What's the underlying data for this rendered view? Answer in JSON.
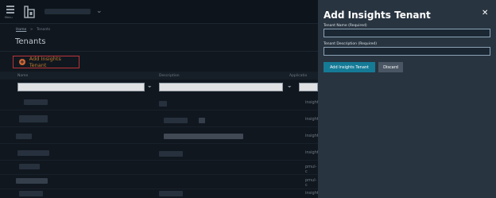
{
  "topbar": {
    "menu_label": "Menu"
  },
  "breadcrumb": {
    "home": "Home",
    "separator": ">",
    "current": "Tenants"
  },
  "page": {
    "title": "Tenants"
  },
  "toolbar": {
    "add_label": "Add Insights Tenant",
    "add_icon": "plus-circle-icon",
    "accent": "#c8393d"
  },
  "table": {
    "columns": [
      "Name",
      "Description",
      "Applicatio"
    ],
    "filter_icon": "funnel-icon",
    "app_cells": [
      "insights",
      "insights",
      "insights",
      "insights",
      "pmul-c",
      "pmul-c",
      "insights"
    ]
  },
  "panel": {
    "title": "Add Insights Tenant",
    "close_icon": "close-icon",
    "name_label": "Tenant Name (Required)",
    "name_value": "",
    "description_label": "Tenant Description (Required)",
    "description_value": "",
    "submit_label": "Add Insights Tenant",
    "discard_label": "Discard",
    "primary_color": "#157a96"
  }
}
